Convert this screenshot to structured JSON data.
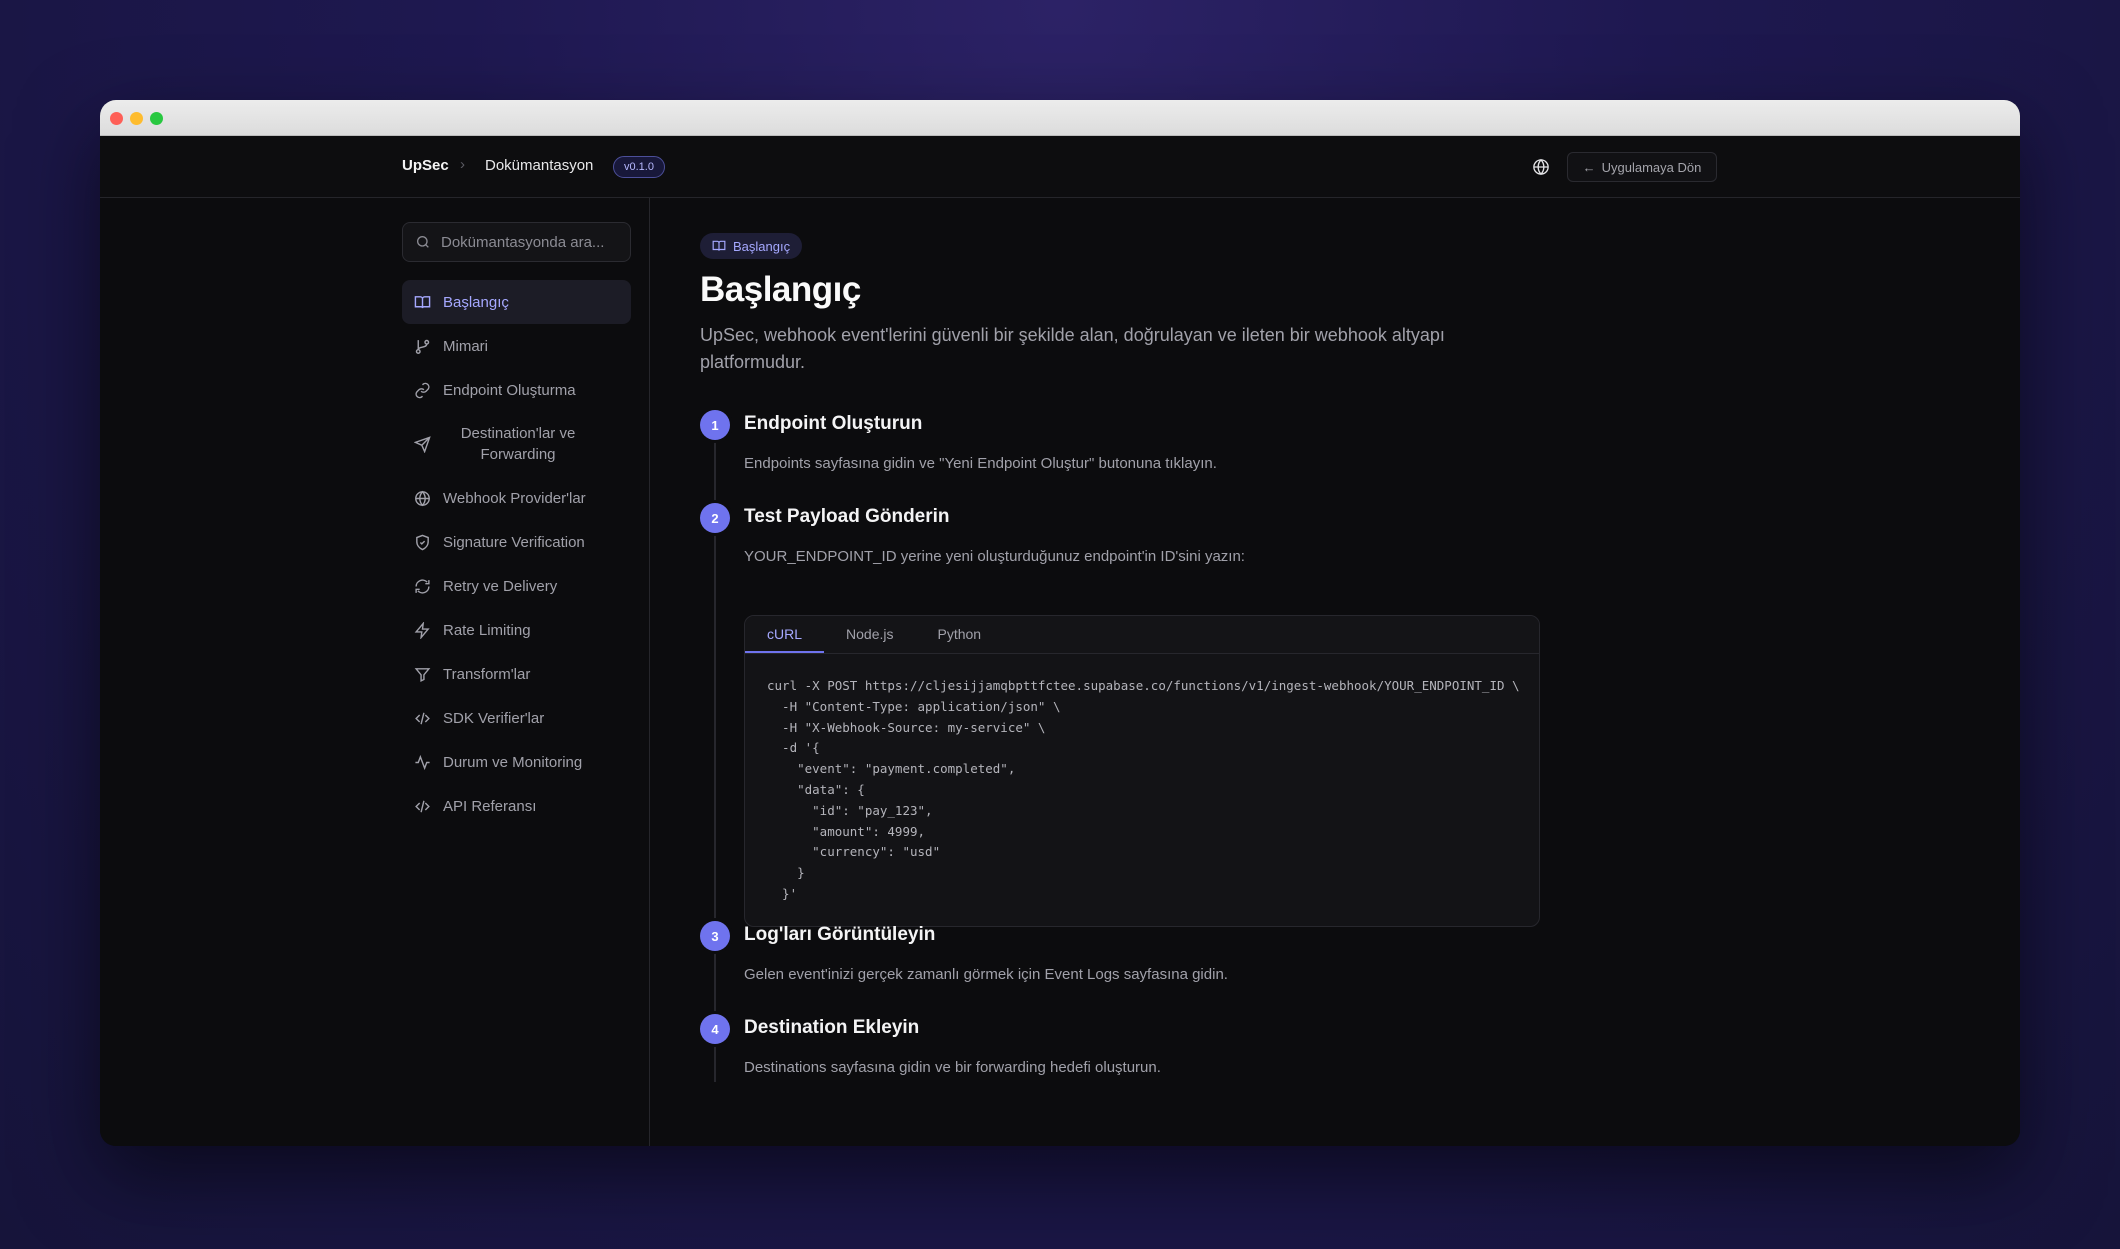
{
  "header": {
    "brand": "UpSec",
    "breadcrumb_separator": "›",
    "breadcrumb": "Dokümantasyon",
    "version": "v0.1.0",
    "back_label": "Uygulamaya Dön",
    "back_arrow": "←"
  },
  "sidebar": {
    "search_placeholder": "Dokümantasyonda ara...",
    "items": [
      {
        "label": "Başlangıç",
        "icon": "book-open-icon",
        "active": true
      },
      {
        "label": "Mimari",
        "icon": "git-branch-icon"
      },
      {
        "label": "Endpoint Oluşturma",
        "icon": "link-icon"
      },
      {
        "label": "Destination'lar ve Forwarding",
        "icon": "send-icon"
      },
      {
        "label": "Webhook Provider'lar",
        "icon": "globe-icon"
      },
      {
        "label": "Signature Verification",
        "icon": "shield-icon"
      },
      {
        "label": "Retry ve Delivery",
        "icon": "refresh-icon"
      },
      {
        "label": "Rate Limiting",
        "icon": "zap-icon"
      },
      {
        "label": "Transform'lar",
        "icon": "filter-icon"
      },
      {
        "label": "SDK Verifier'lar",
        "icon": "code-icon"
      },
      {
        "label": "Durum ve Monitoring",
        "icon": "activity-icon"
      },
      {
        "label": "API Referansı",
        "icon": "code-icon"
      }
    ]
  },
  "main": {
    "pill": "Başlangıç",
    "title": "Başlangıç",
    "description": "UpSec, webhook event'lerini güvenli bir şekilde alan, doğrulayan ve ileten bir webhook altyapı platformudur.",
    "steps": [
      {
        "num": "1",
        "title": "Endpoint Oluşturun",
        "text": "Endpoints sayfasına gidin ve \"Yeni Endpoint Oluştur\" butonuna tıklayın."
      },
      {
        "num": "2",
        "title": "Test Payload Gönderin",
        "text": "YOUR_ENDPOINT_ID yerine yeni oluşturduğunuz endpoint'in ID'sini yazın:"
      },
      {
        "num": "3",
        "title": "Log'ları Görüntüleyin",
        "text": "Gelen event'inizi gerçek zamanlı görmek için Event Logs sayfasına gidin."
      },
      {
        "num": "4",
        "title": "Destination Ekleyin",
        "text": "Destinations sayfasına gidin ve bir forwarding hedefi oluşturun."
      }
    ],
    "code_tabs": [
      "cURL",
      "Node.js",
      "Python"
    ],
    "active_code_tab": "cURL",
    "code": "curl -X POST https://cljesijjamqbpttfctee.supabase.co/functions/v1/ingest-webhook/YOUR_ENDPOINT_ID \\\n  -H \"Content-Type: application/json\" \\\n  -H \"X-Webhook-Source: my-service\" \\\n  -d '{\n    \"event\": \"payment.completed\",\n    \"data\": {\n      \"id\": \"pay_123\",\n      \"amount\": 4999,\n      \"currency\": \"usd\"\n    }\n  }'"
  },
  "colors": {
    "accent": "#6f73ee",
    "accent_text": "#a5a8ff",
    "background": "#0c0c0e"
  }
}
